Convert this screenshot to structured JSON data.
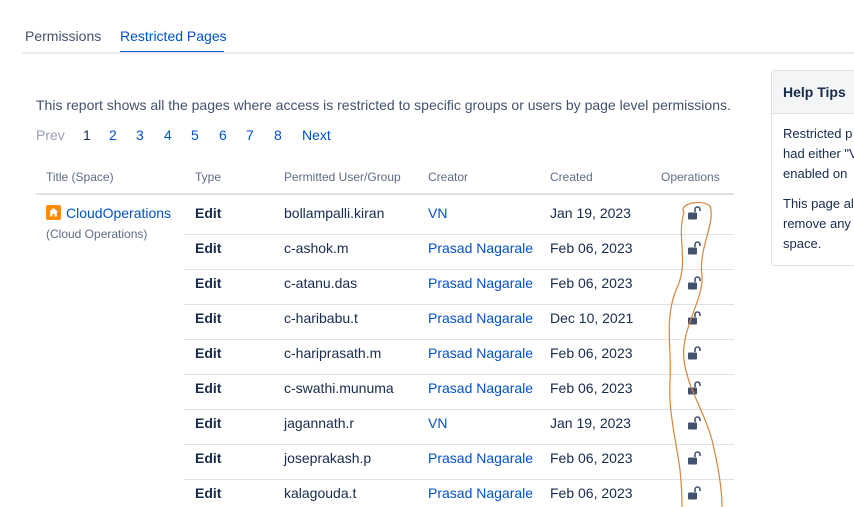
{
  "tabs": [
    {
      "label": "Permissions"
    },
    {
      "label": "Restricted Pages"
    }
  ],
  "description": "This report shows all the pages where access is restricted to specific groups or users by page level permissions.",
  "pagination": {
    "prev": "Prev",
    "pages": [
      "1",
      "2",
      "3",
      "4",
      "5",
      "6",
      "7",
      "8"
    ],
    "current": "1",
    "next": "Next"
  },
  "table": {
    "headers": {
      "title": "Title (Space)",
      "type": "Type",
      "permitted": "Permitted User/Group",
      "creator": "Creator",
      "created": "Created",
      "operations": "Operations"
    },
    "page": {
      "title": "CloudOperations",
      "space": "(Cloud Operations)"
    },
    "rows": [
      {
        "type": "Edit",
        "user": "bollampalli.kiran",
        "creator": "VN",
        "created": "Jan 19, 2023"
      },
      {
        "type": "Edit",
        "user": "c-ashok.m",
        "creator": "Prasad Nagarale",
        "created": "Feb 06, 2023"
      },
      {
        "type": "Edit",
        "user": "c-atanu.das",
        "creator": "Prasad Nagarale",
        "created": "Feb 06, 2023"
      },
      {
        "type": "Edit",
        "user": "c-haribabu.t",
        "creator": "Prasad Nagarale",
        "created": "Dec 10, 2021"
      },
      {
        "type": "Edit",
        "user": "c-hariprasath.m",
        "creator": "Prasad Nagarale",
        "created": "Feb 06, 2023"
      },
      {
        "type": "Edit",
        "user": "c-swathi.munuma",
        "creator": "Prasad Nagarale",
        "created": "Feb 06, 2023"
      },
      {
        "type": "Edit",
        "user": "jagannath.r",
        "creator": "VN",
        "created": "Jan 19, 2023"
      },
      {
        "type": "Edit",
        "user": "joseprakash.p",
        "creator": "Prasad Nagarale",
        "created": "Feb 06, 2023"
      },
      {
        "type": "Edit",
        "user": "kalagouda.t",
        "creator": "Prasad Nagarale",
        "created": "Feb 06, 2023"
      }
    ]
  },
  "help": {
    "title": "Help Tips",
    "lines": [
      "Restricted p",
      "had either \"V",
      "enabled on",
      "This page al",
      "remove any",
      "space."
    ]
  },
  "icons": {
    "space": "home-icon",
    "operation": "unlock-icon"
  },
  "colors": {
    "link": "#0052cc",
    "space_icon": "#ff8b00",
    "annotation": "#d9843b"
  }
}
